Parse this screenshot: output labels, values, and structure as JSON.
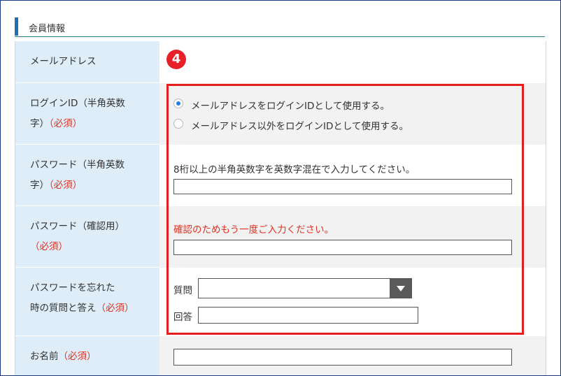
{
  "section": {
    "title": "会員情報"
  },
  "badge": {
    "number": "4"
  },
  "rows": {
    "email": {
      "label": "メールアドレス"
    },
    "login_id": {
      "label_line1": "ログインID（半角英数",
      "label_line2": "字）",
      "required": "（必須）",
      "options": [
        {
          "label": "メールアドレスをログインIDとして使用する。",
          "checked": true
        },
        {
          "label": "メールアドレス以外をログインIDとして使用する。",
          "checked": false
        }
      ]
    },
    "password": {
      "label_line1": "パスワード（半角英数",
      "label_line2": "字）",
      "required": "（必須）",
      "note": "8桁以上の半角英数字を英数字混在で入力してください。",
      "value": ""
    },
    "password_confirm": {
      "label_line1": "パスワード（確認用）",
      "required": "（必須）",
      "note": "確認のためもう一度ご入力ください。",
      "value": ""
    },
    "secret": {
      "label_line1": "パスワードを忘れた",
      "label_line2": "時の質問と答え",
      "required": "（必須）",
      "question_label": "質問",
      "question_value": "",
      "answer_label": "回答",
      "answer_value": ""
    },
    "name": {
      "label": "お名前",
      "required": "（必須）",
      "value": ""
    }
  },
  "colors": {
    "accent": "#1a6fb5",
    "required": "#e03020",
    "highlight_box": "#e51d1d",
    "label_bg": "#deedf8"
  }
}
